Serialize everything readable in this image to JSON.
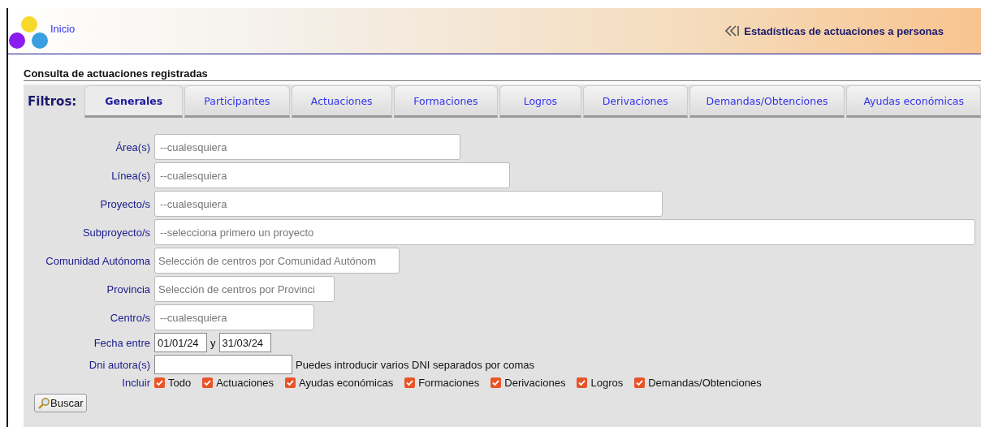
{
  "header": {
    "home_link": "Inicio",
    "section_link": "Estadísticas de actuaciones a personas"
  },
  "title": "Consulta de actuaciones registradas",
  "filters_label": "Filtros:",
  "tabs": [
    {
      "label": "Generales",
      "selected": true
    },
    {
      "label": "Participantes",
      "selected": false
    },
    {
      "label": "Actuaciones",
      "selected": false
    },
    {
      "label": "Formaciones",
      "selected": false
    },
    {
      "label": "Logros",
      "selected": false
    },
    {
      "label": "Derivaciones",
      "selected": false
    },
    {
      "label": "Demandas/Obtenciones",
      "selected": false
    },
    {
      "label": "Ayudas económicas",
      "selected": false
    }
  ],
  "fields": [
    {
      "label": "Área(s)",
      "kind": "select",
      "placeholder": "--cualesquiera"
    },
    {
      "label": "Línea(s)",
      "kind": "select",
      "placeholder": "--cualesquiera"
    },
    {
      "label": "Proyecto/s",
      "kind": "select",
      "placeholder": "--cualesquiera"
    },
    {
      "label": "Subproyecto/s",
      "kind": "select",
      "placeholder": "--selecciona primero un proyecto"
    },
    {
      "label": "Comunidad Autónoma",
      "kind": "text",
      "placeholder": "Selección de centros por Comunidad Autónom"
    },
    {
      "label": "Provincia",
      "kind": "text",
      "placeholder": "Selección de centros por Provinci"
    },
    {
      "label": "Centro/s",
      "kind": "select",
      "placeholder": "--cualesquiera"
    }
  ],
  "date_range": {
    "label": "Fecha entre",
    "from": "01/01/24",
    "separator": "y",
    "to": "31/03/24"
  },
  "dni": {
    "label": "Dni autora(s)",
    "hint": "Puedes introducir varios DNI separados por comas"
  },
  "include": {
    "label": "Incluir",
    "options": [
      {
        "label": "Todo",
        "checked": true
      },
      {
        "label": "Actuaciones",
        "checked": true
      },
      {
        "label": "Ayudas económicas",
        "checked": true
      },
      {
        "label": "Formaciones",
        "checked": true
      },
      {
        "label": "Derivaciones",
        "checked": true
      },
      {
        "label": "Logros",
        "checked": true
      },
      {
        "label": "Demandas/Obtenciones",
        "checked": true
      }
    ]
  },
  "search_button": "Buscar"
}
